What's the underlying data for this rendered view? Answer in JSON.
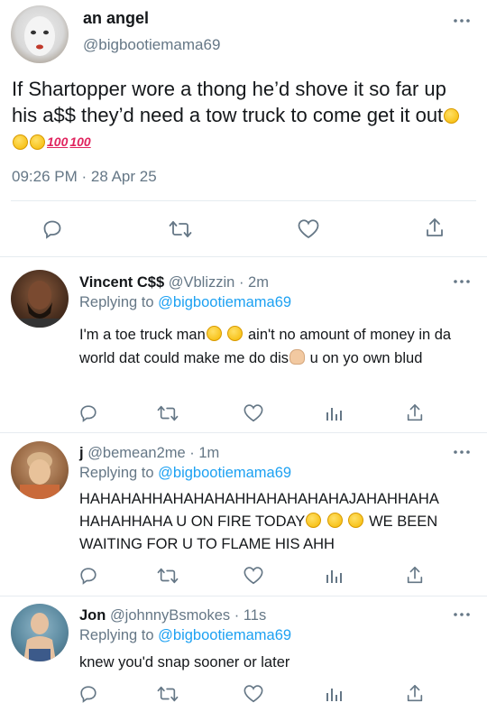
{
  "main_tweet": {
    "name": "an angel",
    "handle": "@bigbootiemama69",
    "text": "If Shartopper wore a thong he’d shove it so far up his a$$ they’d need a tow truck to come get it out",
    "emoji_100": "100",
    "timestamp": "09:26 PM · 28 Apr 25"
  },
  "replies": [
    {
      "name": "Vincent C$$",
      "meta": "@Vblizzin · 2m",
      "replying_prefix": "Replying to",
      "replying_handle": "@bigbootiemama69",
      "text_a": "I'm a toe truck man",
      "text_b": "ain't no amount of money in da world dat could make me do dis",
      "text_c": " u on yo own blud"
    },
    {
      "name": "j",
      "meta": "@bemean2me · 1m",
      "replying_prefix": "Replying to",
      "replying_handle": "@bigbootiemama69",
      "text_a": "HAHAHAHHAHAHAHAHHAHAHAHAHAJAHAHHAHA HAHAHHAHA U ON FIRE TODAY",
      "text_b": " WE BEEN WAITING FOR U TO FLAME HIS AHH"
    },
    {
      "name": "Jon",
      "meta": "@johnnyBsmokes · 11s",
      "replying_prefix": "Replying to",
      "replying_handle": "@bigbootiemama69",
      "text_a": "knew you'd snap sooner or later"
    }
  ],
  "icons": [
    "reply-icon",
    "retweet-icon",
    "like-icon",
    "share-icon",
    "analytics-icon",
    "more-icon"
  ],
  "colors": {
    "link": "#1da1f2",
    "secondary": "#657786",
    "divider": "#e6ecf0"
  }
}
